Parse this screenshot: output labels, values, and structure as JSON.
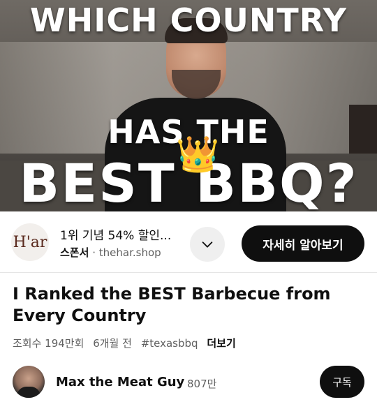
{
  "thumbnail": {
    "line1": "WHICH COUNTRY",
    "line2": "HAS THE",
    "line3": "BEST BBQ?",
    "crown_emoji": "👑"
  },
  "sponsor": {
    "logo_text": "H'ar",
    "title": "1위 기념 54% 할인...",
    "label": "스폰서",
    "separator": "·",
    "domain": "thehar.shop",
    "expand_icon": "chevron-down-icon",
    "cta_label": "자세히 알아보기"
  },
  "video": {
    "title": "I Ranked the BEST Barbecue from Every Country",
    "views": "조회수 194만회",
    "age": "6개월 전",
    "hashtag": "#texasbbq",
    "more": "더보기"
  },
  "channel": {
    "name": "Max the Meat Guy",
    "subscribers": "807만",
    "subscribe_label": "구독"
  }
}
